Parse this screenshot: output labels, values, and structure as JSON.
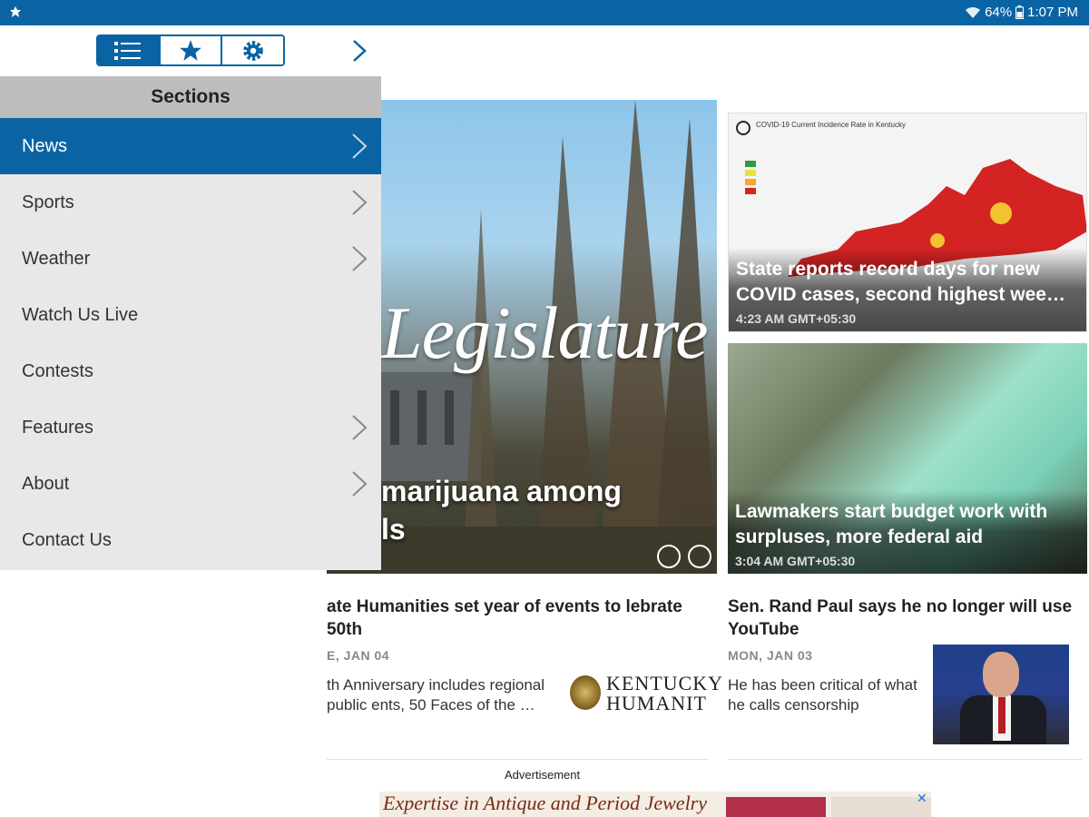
{
  "status_bar": {
    "battery": "64%",
    "time": "1:07 PM"
  },
  "toolbar": {
    "tabs": [
      {
        "icon": "list-icon",
        "active": true
      },
      {
        "icon": "star-icon",
        "active": false
      },
      {
        "icon": "gear-icon",
        "active": false
      }
    ],
    "close_drawer_icon": "chevron-right-icon"
  },
  "drawer": {
    "header": "Sections",
    "items": [
      {
        "label": "News",
        "has_submenu": true,
        "active": true
      },
      {
        "label": "Sports",
        "has_submenu": true,
        "active": false
      },
      {
        "label": "Weather",
        "has_submenu": true,
        "active": false
      },
      {
        "label": "Watch Us Live",
        "has_submenu": false,
        "active": false
      },
      {
        "label": "Contests",
        "has_submenu": false,
        "active": false
      },
      {
        "label": "Features",
        "has_submenu": true,
        "active": false
      },
      {
        "label": "About",
        "has_submenu": true,
        "active": false
      },
      {
        "label": "Contact Us",
        "has_submenu": false,
        "active": false
      }
    ]
  },
  "hero": {
    "image_word": "Legislature",
    "headline": "marijuana among\nls"
  },
  "cards": [
    {
      "map_title": "COVID-19 Current Incidence Rate in Kentucky",
      "title": "State reports record days for new COVID cases, second highest wee…",
      "time": "4:23 AM GMT+05:30"
    },
    {
      "title": "Lawmakers start budget work with surpluses, more federal aid",
      "time": "3:04 AM GMT+05:30"
    }
  ],
  "stories": [
    {
      "title": "ate Humanities set year of events to lebrate 50th",
      "date": "E, JAN 04",
      "summary": "th Anniversary includes regional public ents, 50 Faces of the …",
      "logo_line1": "KENTUCKY",
      "logo_line2": "HUMANIT"
    },
    {
      "title": "Sen. Rand Paul says he no longer will use YouTube",
      "date": "MON, JAN 03",
      "summary": "He has been critical of what he calls censorship"
    }
  ],
  "ad": {
    "label": "Advertisement",
    "text": "Expertise in Antique and Period Jewelry",
    "close": "✕"
  },
  "colors": {
    "brand": "#0a64a4",
    "drawer_bg": "#e8e8e8",
    "drawer_header_bg": "#bdbdbd"
  }
}
